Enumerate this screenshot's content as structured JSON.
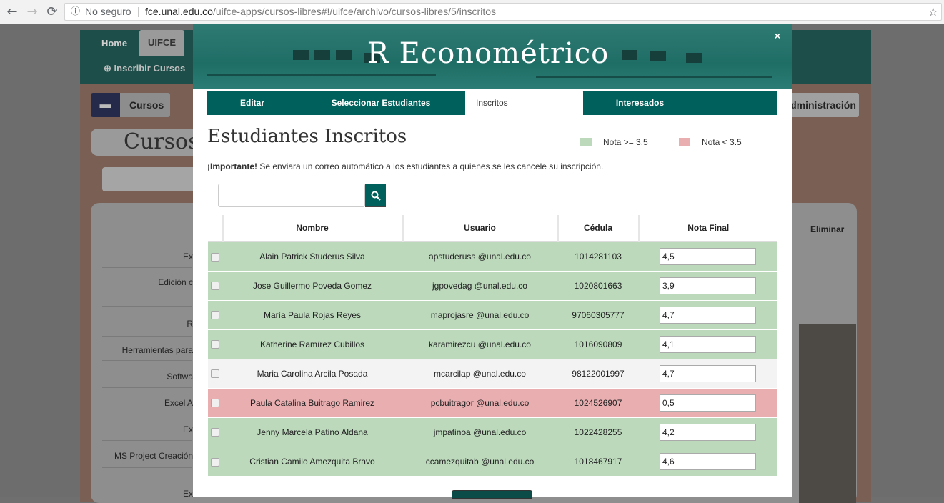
{
  "browser": {
    "back_icon": "←",
    "forward_icon": "→",
    "reload_icon": "⟳",
    "info_icon": "ⓘ",
    "security": "No seguro",
    "host": "fce.unal.edu.co",
    "path": "/uifce-apps/cursos-libres#!/uifce/archivo/cursos-libres/5/inscritos",
    "star_icon": "☆"
  },
  "background": {
    "nav_home": "Home",
    "nav_uifce": "UIFCE",
    "inscribir": "Inscribir Cursos",
    "cursos_btn": "Cursos",
    "cursos_heading": "Cursos",
    "right_btn": "Administración Home",
    "eliminar": "Eliminar",
    "row_labels": [
      "Ex",
      "Edición c",
      "R",
      "Herramientas para",
      "Softwa",
      "Excel A",
      "Ex",
      "MS Project Creación",
      "Ex"
    ]
  },
  "modal": {
    "title": "R Econométrico",
    "close": "×",
    "tabs": [
      {
        "label": "Editar",
        "active": false
      },
      {
        "label": "Seleccionar Estudiantes",
        "active": false
      },
      {
        "label": "Inscritos",
        "active": true
      },
      {
        "label": "Interesados",
        "active": false
      }
    ],
    "heading": "Estudiantes Inscritos",
    "legend": [
      {
        "label": "Nota >= 3.5",
        "color": "#bcd9bc"
      },
      {
        "label": "Nota < 3.5",
        "color": "#e8aeb0"
      }
    ],
    "important_bold": "¡Importante!",
    "important_text": " Se enviara un correo automático a los estudiantes a quienes se les cancele su inscripción.",
    "search_placeholder": "",
    "search_icon": "search-icon",
    "columns": [
      "",
      "Nombre",
      "Usuario",
      "Cédula",
      "Nota Final"
    ],
    "rows": [
      {
        "nombre": "Alain Patrick Studerus Silva",
        "usuario": "apstuderuss @unal.edu.co",
        "cedula": "1014281103",
        "nota": "4,5",
        "status": "ok"
      },
      {
        "nombre": "Jose Guillermo Poveda Gomez",
        "usuario": "jgpovedag @unal.edu.co",
        "cedula": "1020801663",
        "nota": "3,9",
        "status": "ok"
      },
      {
        "nombre": "María Paula Rojas Reyes",
        "usuario": "maprojasre @unal.edu.co",
        "cedula": "97060305777",
        "nota": "4,7",
        "status": "ok"
      },
      {
        "nombre": "Katherine Ramírez Cubillos",
        "usuario": "karamirezcu @unal.edu.co",
        "cedula": "1016090809",
        "nota": "4,1",
        "status": "ok"
      },
      {
        "nombre": "Maria Carolina Arcila Posada",
        "usuario": "mcarcilap @unal.edu.co",
        "cedula": "98122001997",
        "nota": "4,7",
        "status": "neu"
      },
      {
        "nombre": "Paula Catalina Buitrago Ramirez",
        "usuario": "pcbuitragor @unal.edu.co",
        "cedula": "1024526907",
        "nota": "0,5",
        "status": "bad"
      },
      {
        "nombre": "Jenny Marcela Patino Aldana",
        "usuario": "jmpatinoa @unal.edu.co",
        "cedula": "1022428255",
        "nota": "4,2",
        "status": "ok"
      },
      {
        "nombre": "Cristian Camilo Amezquita Bravo",
        "usuario": "ccamezquitab @unal.edu.co",
        "cedula": "1018467917",
        "nota": "4,6",
        "status": "ok"
      }
    ]
  }
}
